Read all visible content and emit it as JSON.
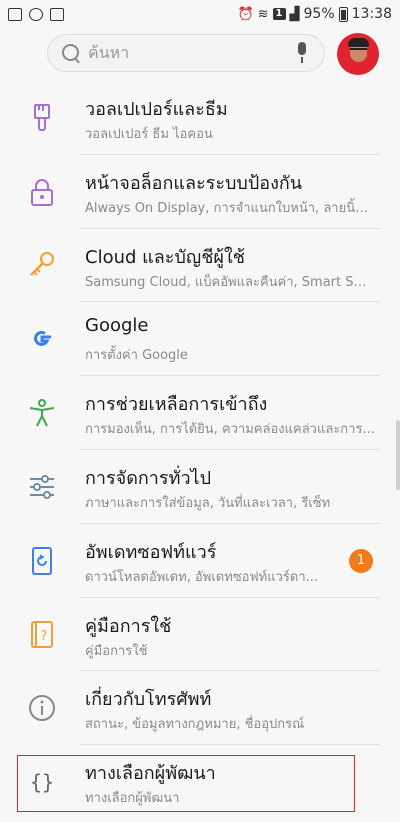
{
  "status_bar": {
    "battery": "95%",
    "time": "13:38",
    "sim": "1",
    "icons": [
      "image-icon",
      "sync-icon",
      "clipboard-icon",
      "alarm-icon",
      "wifi-icon",
      "sim-icon",
      "signal-icon",
      "battery-icon"
    ]
  },
  "search": {
    "placeholder": "ค้นหา"
  },
  "items": [
    {
      "title": "วอลเปเปอร์และธีม",
      "subtitle": "วอลเปเปอร์ ธีม ไอคอน",
      "icon": "paintbrush-icon",
      "color": "#a56fd2"
    },
    {
      "title": "หน้าจอล็อกและระบบป้องกัน",
      "subtitle": "Always On Display, การจำแนกใบหน้า, ลายนิ้วมื...",
      "icon": "lock-icon",
      "color": "#a56fd2"
    },
    {
      "title": "Cloud และบัญชีผู้ใช้",
      "subtitle": "Samsung Cloud, แบ็คอัพและคืนค่า, Smart Sw...",
      "icon": "key-icon",
      "color": "#f0a034"
    },
    {
      "title": "Google",
      "subtitle": "การตั้งค่า Google",
      "icon": "google-icon",
      "color": "#3d7ef0"
    },
    {
      "title": "การช่วยเหลือการเข้าถึง",
      "subtitle": "การมองเห็น, การได้ยิน, ความคล่องแคล่วและการ...",
      "icon": "accessibility-icon",
      "color": "#3aa952"
    },
    {
      "title": "การจัดการทั่วไป",
      "subtitle": "ภาษาและการใส่ข้อมูล, วันที่และเวลา, รีเซ็ท",
      "icon": "sliders-icon",
      "color": "#6c8ea8"
    },
    {
      "title": "อัพเดทซอฟท์แวร์",
      "subtitle": "ดาวน์โหลดอัพเดท, อัพเดทซอฟท์แวร์ดา...",
      "icon": "update-icon",
      "color": "#3d7ef0",
      "badge": "1"
    },
    {
      "title": "คู่มือการใช้",
      "subtitle": "คู่มือการใช้",
      "icon": "manual-icon",
      "color": "#f0a034"
    },
    {
      "title": "เกี่ยวกับโทรศัพท์",
      "subtitle": "สถานะ, ข้อมูลทางกฎหมาย, ชื่ออุปกรณ์",
      "icon": "info-icon",
      "color": "#888888"
    },
    {
      "title": "ทางเลือกผู้พัฒนา",
      "subtitle": "ทางเลือกผู้พัฒนา",
      "icon": "braces-icon",
      "color": "#666666"
    }
  ],
  "colors": {
    "highlight": "#e02424",
    "badge": "#f37a18"
  }
}
